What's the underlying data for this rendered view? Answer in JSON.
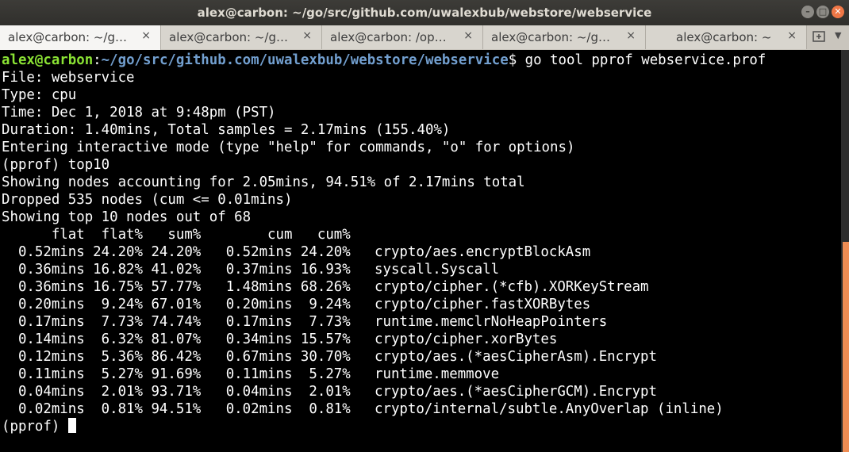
{
  "window": {
    "title": "alex@carbon: ~/go/src/github.com/uwalexbub/webstore/webservice"
  },
  "tabs": [
    {
      "label": "alex@carbon: ~/g…",
      "active": true
    },
    {
      "label": "alex@carbon: ~/g…",
      "active": false
    },
    {
      "label": "alex@carbon: /op…",
      "active": false
    },
    {
      "label": "alex@carbon: ~/g…",
      "active": false
    },
    {
      "label": "alex@carbon: ~",
      "active": false
    }
  ],
  "terminal": {
    "prompt_user": "alex@carbon",
    "prompt_path": "~/go/src/github.com/uwalexbub/webstore/webservice",
    "command": "$ go tool pprof webservice.prof",
    "lines": [
      "File: webservice",
      "Type: cpu",
      "Time: Dec 1, 2018 at 9:48pm (PST)",
      "Duration: 1.40mins, Total samples = 2.17mins (155.40%)",
      "Entering interactive mode (type \"help\" for commands, \"o\" for options)",
      "(pprof) top10",
      "Showing nodes accounting for 2.05mins, 94.51% of 2.17mins total",
      "Dropped 535 nodes (cum <= 0.01mins)",
      "Showing top 10 nodes out of 68"
    ],
    "table_header": "      flat  flat%   sum%        cum   cum%",
    "rows": [
      {
        "stats": "  0.52mins 24.20% 24.20%   0.52mins 24.20%",
        "func": "crypto/aes.encryptBlockAsm"
      },
      {
        "stats": "  0.36mins 16.82% 41.02%   0.37mins 16.93%",
        "func": "syscall.Syscall"
      },
      {
        "stats": "  0.36mins 16.75% 57.77%   1.48mins 68.26%",
        "func": "crypto/cipher.(*cfb).XORKeyStream"
      },
      {
        "stats": "  0.20mins  9.24% 67.01%   0.20mins  9.24%",
        "func": "crypto/cipher.fastXORBytes"
      },
      {
        "stats": "  0.17mins  7.73% 74.74%   0.17mins  7.73%",
        "func": "runtime.memclrNoHeapPointers"
      },
      {
        "stats": "  0.14mins  6.32% 81.07%   0.34mins 15.57%",
        "func": "crypto/cipher.xorBytes"
      },
      {
        "stats": "  0.12mins  5.36% 86.42%   0.67mins 30.70%",
        "func": "crypto/aes.(*aesCipherAsm).Encrypt"
      },
      {
        "stats": "  0.11mins  5.27% 91.69%   0.11mins  5.27%",
        "func": "runtime.memmove"
      },
      {
        "stats": "  0.04mins  2.01% 93.71%   0.04mins  2.01%",
        "func": "crypto/aes.(*aesCipherGCM).Encrypt"
      },
      {
        "stats": "  0.02mins  0.81% 94.51%   0.02mins  0.81%",
        "func": "crypto/internal/subtle.AnyOverlap (inline)"
      }
    ],
    "final_prompt": "(pprof) "
  },
  "icons": {
    "minimize": "minimize-icon",
    "maximize": "maximize-icon",
    "close": "close-icon",
    "new_tab": "plus-icon",
    "tab_menu": "chevron-down-icon"
  },
  "colors": {
    "prompt_user": "#8ae234",
    "prompt_path": "#729fcf",
    "close_button": "#f07746",
    "scrollbar_thumb": "#ee8c53",
    "terminal_bg": "#000000"
  }
}
